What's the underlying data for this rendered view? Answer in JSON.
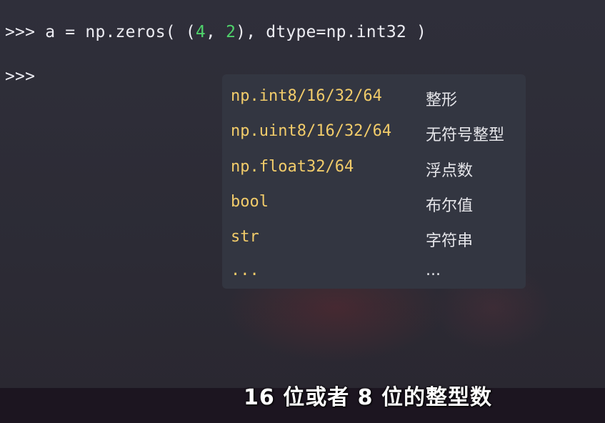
{
  "terminal": {
    "line1": {
      "prompt": ">>>",
      "code_a": " a = np.zeros( (",
      "num1": "4",
      "code_b": ", ",
      "num2": "2",
      "code_c": "), dtype=np.int32 )"
    },
    "line2": {
      "prompt": ">>>"
    }
  },
  "popup": {
    "rows": [
      {
        "dtype": "np.int8/16/32/64",
        "meaning": "整形"
      },
      {
        "dtype": "np.uint8/16/32/64",
        "meaning": "无符号整型"
      },
      {
        "dtype": "np.float32/64",
        "meaning": "浮点数"
      },
      {
        "dtype": "bool",
        "meaning": "布尔值"
      },
      {
        "dtype": "str",
        "meaning": "字符串"
      },
      {
        "dtype": "...",
        "meaning": "..."
      }
    ]
  },
  "subtitle": "16 位或者 8 位的整型数",
  "colors": {
    "dtype_text": "#f2cc6a",
    "number_highlight": "#4fd36b",
    "popup_bg": "#333641"
  }
}
